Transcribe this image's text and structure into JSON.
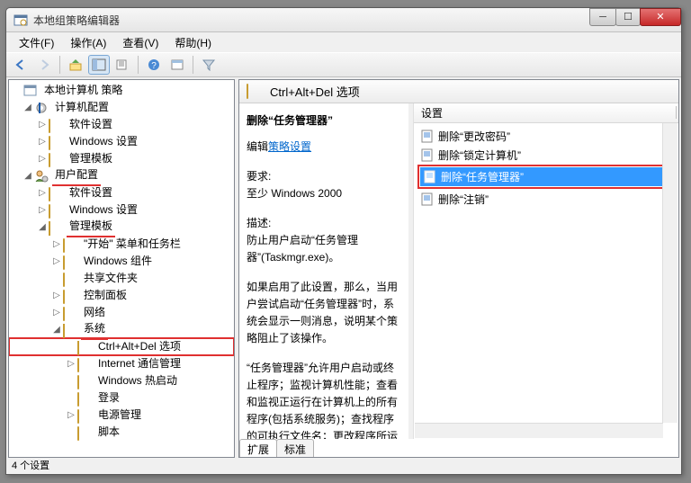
{
  "window": {
    "title": "本地组策略编辑器"
  },
  "menu": {
    "file": "文件(F)",
    "action": "操作(A)",
    "view": "查看(V)",
    "help": "帮助(H)"
  },
  "tree": {
    "root": "本地计算机 策略",
    "computer": "计算机配置",
    "c_soft": "软件设置",
    "c_win": "Windows 设置",
    "c_admin": "管理模板",
    "user": "用户配置",
    "u_soft": "软件设置",
    "u_win": "Windows 设置",
    "u_admin": "管理模板",
    "startmenu": "\"开始\" 菜单和任务栏",
    "wincomp": "Windows 组件",
    "shared": "共享文件夹",
    "control": "控制面板",
    "network": "网络",
    "system": "系统",
    "ctrlaltdel": "Ctrl+Alt+Del 选项",
    "inet": "Internet 通信管理",
    "winhot": "Windows 热启动",
    "logon": "登录",
    "power": "电源管理",
    "scripts": "脚本"
  },
  "right": {
    "header": "Ctrl+Alt+Del 选项",
    "desc_title": "删除“任务管理器”",
    "edit_link_label": "编辑",
    "policy_link": "策略设置",
    "req_label": "要求:",
    "req_value": "至少 Windows 2000",
    "desc_label": "描述:",
    "desc_p1": "防止用户启动“任务管理器”(Taskmgr.exe)。",
    "desc_p2": "如果启用了此设置，那么，当用户尝试启动“任务管理器”时，系统会显示一则消息，说明某个策略阻止了该操作。",
    "desc_p3": "“任务管理器”允许用户启动或终止程序；监视计算机性能；查看和监视正运行在计算机上的所有程序(包括系统服务)；查找程序的可执行文件名；更改程序所运行的进程",
    "list_header": "设置",
    "items": [
      "删除“更改密码”",
      "删除“锁定计算机”",
      "删除“任务管理器”",
      "删除“注销”"
    ],
    "tab_ext": "扩展",
    "tab_std": "标准"
  },
  "status": "4 个设置"
}
